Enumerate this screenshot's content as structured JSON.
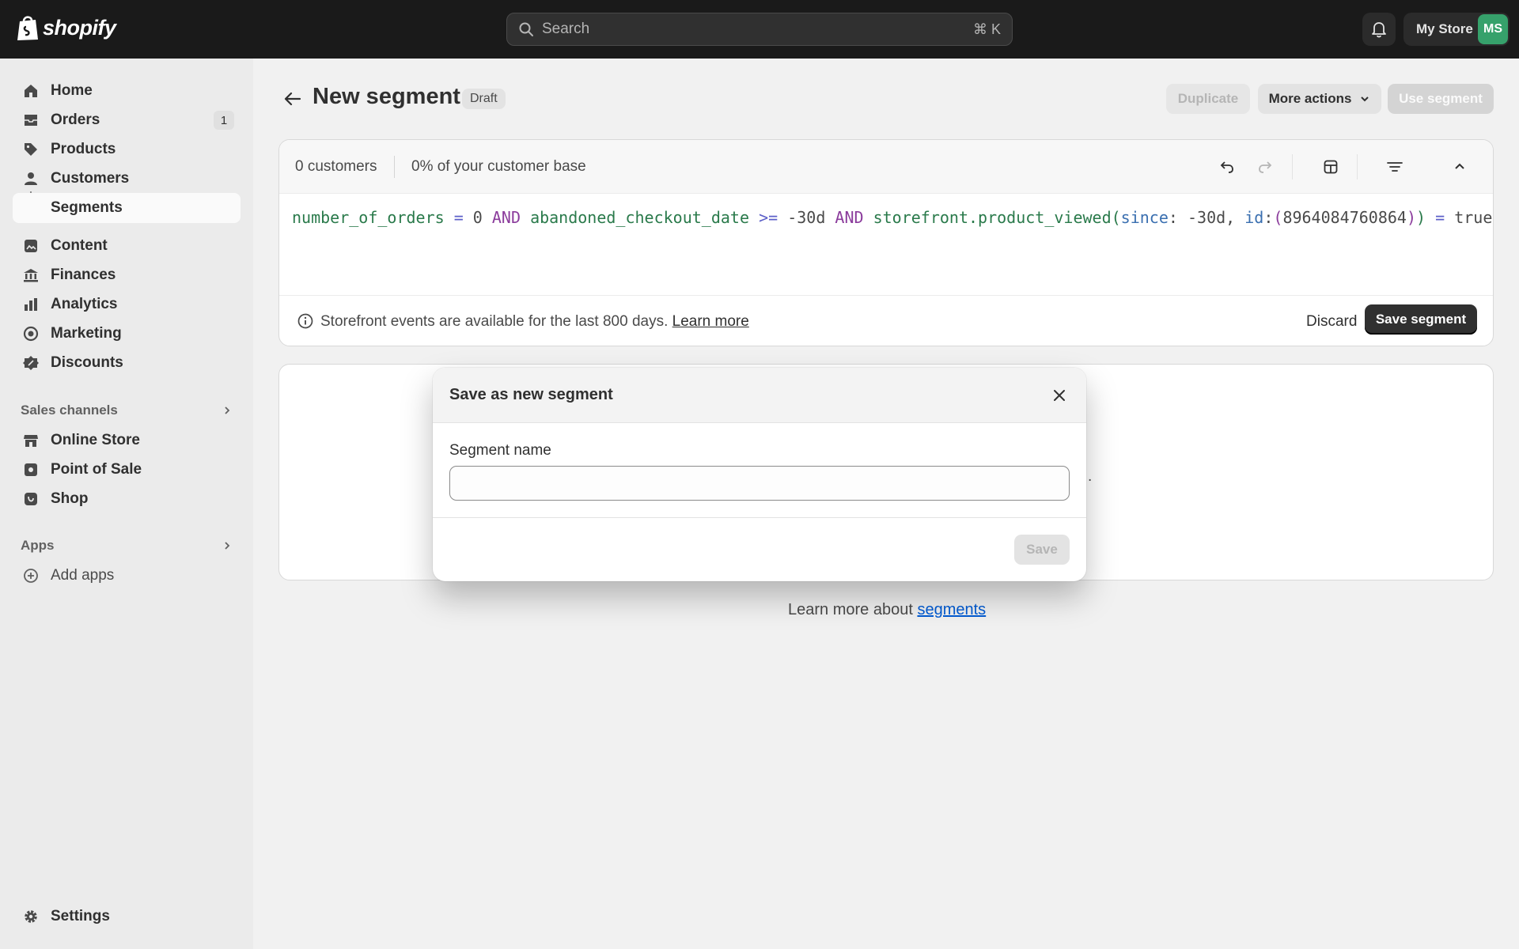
{
  "topbar": {
    "logo_text": "shopify",
    "search_placeholder": "Search",
    "search_shortcut": "⌘ K",
    "store_name": "My Store",
    "avatar_initials": "MS"
  },
  "sidebar": {
    "items": [
      {
        "label": "Home",
        "icon": "home-icon"
      },
      {
        "label": "Orders",
        "icon": "orders-icon",
        "badge": "1"
      },
      {
        "label": "Products",
        "icon": "tag-icon"
      },
      {
        "label": "Customers",
        "icon": "person-icon"
      },
      {
        "label": "Segments",
        "active": true
      },
      {
        "label": "Content",
        "icon": "content-icon"
      },
      {
        "label": "Finances",
        "icon": "bank-icon"
      },
      {
        "label": "Analytics",
        "icon": "chart-icon"
      },
      {
        "label": "Marketing",
        "icon": "target-icon"
      },
      {
        "label": "Discounts",
        "icon": "discount-icon"
      }
    ],
    "sales_channels_label": "Sales channels",
    "channels": [
      {
        "label": "Online Store",
        "icon": "store-icon"
      },
      {
        "label": "Point of Sale",
        "icon": "pos-icon"
      },
      {
        "label": "Shop",
        "icon": "shop-icon"
      }
    ],
    "apps_label": "Apps",
    "add_apps_label": "Add apps",
    "settings_label": "Settings"
  },
  "header": {
    "title": "New segment",
    "badge": "Draft",
    "duplicate_label": "Duplicate",
    "more_actions_label": "More actions",
    "use_segment_label": "Use segment"
  },
  "editor": {
    "customer_count": "0 customers",
    "base_percent": "0% of your customer base",
    "query": {
      "attr1": "number_of_orders",
      "op1": "=",
      "val1": "0",
      "and1": "AND",
      "attr2": "abandoned_checkout_date",
      "op2": ">=",
      "val2": "-30d",
      "and2": "AND",
      "fn": "storefront.product_viewed",
      "paren_open": "(",
      "param1": "since",
      "colon1": ":",
      "pval1": "-30d,",
      "param2": "id",
      "colon2": ":",
      "pval2_open": "(",
      "pval2": "8964084760864",
      "pval2_close": ")",
      "paren_close": ")",
      "op3": "=",
      "val3": "true"
    },
    "info_text": "Storefront events are available for the last 800 days.",
    "info_link": "Learn more",
    "discard_label": "Discard",
    "save_segment_label": "Save segment"
  },
  "results": {
    "peek_text": "."
  },
  "footer": {
    "learn_more_prefix": "Learn more about",
    "learn_more_link": "segments"
  },
  "modal": {
    "title": "Save as new segment",
    "field_label": "Segment name",
    "field_value": "",
    "save_label": "Save"
  }
}
